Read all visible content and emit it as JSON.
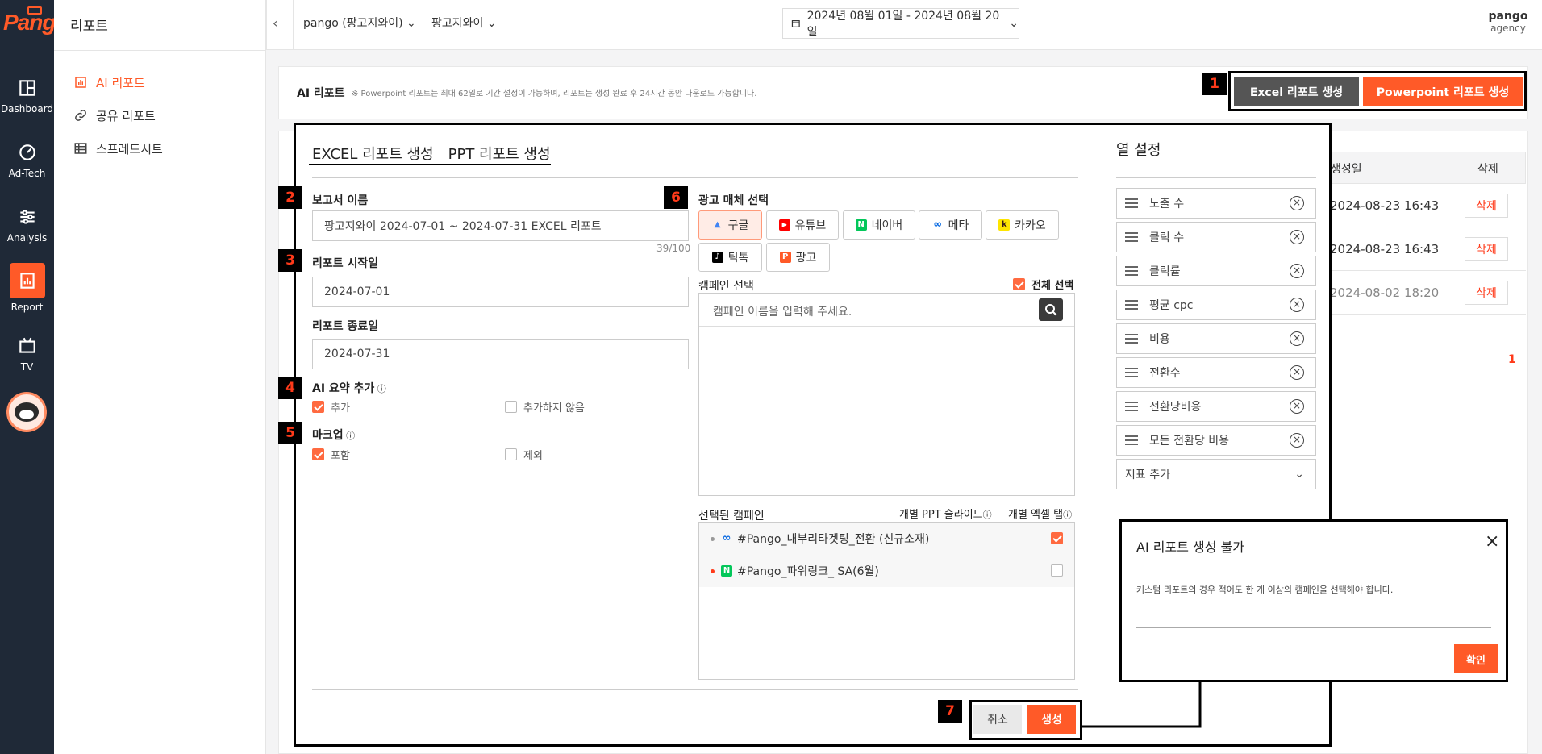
{
  "app": {
    "logo": "Pango",
    "sub_title": "리포트"
  },
  "rail": [
    {
      "label": "Dashboard",
      "icon": "dashboard-icon"
    },
    {
      "label": "Ad-Tech",
      "icon": "adtech-icon"
    },
    {
      "label": "Analysis",
      "icon": "analysis-icon"
    },
    {
      "label": "Report",
      "icon": "report-icon",
      "active": true
    },
    {
      "label": "TV",
      "icon": "tv-icon"
    }
  ],
  "subnav": [
    {
      "label": "AI 리포트",
      "icon": "chart-icon",
      "active": true
    },
    {
      "label": "공유 리포트",
      "icon": "link-icon"
    },
    {
      "label": "스프레드시트",
      "icon": "table-icon"
    }
  ],
  "topbar": {
    "account": "pango (팡고지와이)",
    "advertiser": "팡고지와이",
    "date_range": "2024년 08월 01일 - 2024년 08월 20일",
    "user_name": "pango",
    "user_role": "agency"
  },
  "header": {
    "title": "AI 리포트",
    "notice": "※ Powerpoint 리포트는 최대 62일로 기간 설정이 가능하며, 리포트는 생성 완료 후 24시간 동안 다운로드 가능합니다.",
    "excel_btn": "Excel 리포트 생성",
    "ppt_btn": "Powerpoint 리포트 생성"
  },
  "markers": [
    "1",
    "2",
    "3",
    "4",
    "5",
    "6",
    "7"
  ],
  "table": {
    "col_created": "생성일",
    "col_delete": "삭제",
    "rows": [
      {
        "created": "2024-08-23 16:43",
        "delete": "삭제"
      },
      {
        "created": "2024-08-23 16:43",
        "delete": "삭제"
      },
      {
        "created": "2024-08-02 18:20",
        "delete": "삭제"
      }
    ],
    "page": "1"
  },
  "modal": {
    "tab_excel": "EXCEL 리포트 생성",
    "tab_ppt": "PPT 리포트 생성",
    "report_name_label": "보고서 이름",
    "report_name_value": "팡고지와이 2024-07-01 ~ 2024-07-31 EXCEL 리포트",
    "report_name_count": "39/100",
    "start_label": "리포트 시작일",
    "start_value": "2024-07-01",
    "end_label": "리포트 종료일",
    "end_value": "2024-07-31",
    "ai_label": "AI 요약 추가",
    "ai_opt_add": "추가",
    "ai_opt_none": "추가하지 않음",
    "markup_label": "마크업",
    "markup_opt_in": "포함",
    "markup_opt_out": "제외",
    "media_label": "광고 매체 선택",
    "media": [
      {
        "label": "구글",
        "icon": "google-icon"
      },
      {
        "label": "유튜브",
        "icon": "youtube-icon"
      },
      {
        "label": "네이버",
        "icon": "naver-icon"
      },
      {
        "label": "메타",
        "icon": "meta-icon"
      },
      {
        "label": "카카오",
        "icon": "kakao-icon"
      },
      {
        "label": "틱톡",
        "icon": "tiktok-icon"
      },
      {
        "label": "팡고",
        "icon": "pango-icon"
      }
    ],
    "campaign_label": "캠페인 선택",
    "select_all": "전체 선택",
    "campaign_placeholder": "캠페인 이름을 입력해 주세요.",
    "selected_label": "선택된 캠페인",
    "col_ppt": "개별 PPT 슬라이드",
    "col_excel": "개별 엑셀 탭",
    "selected": [
      {
        "name": "#Pango_내부리타겟팅_전환 (신규소재)",
        "icon": "meta-icon",
        "dot": "#999999",
        "checked": true
      },
      {
        "name": "#Pango_파워링크_ SA(6월)",
        "icon": "naver-icon",
        "dot": "#ff3a1a",
        "checked": false
      }
    ],
    "cancel": "취소",
    "create": "생성",
    "col_settings_title": "열 설정",
    "columns": [
      "노출 수",
      "클릭 수",
      "클릭률",
      "평균 cpc",
      "비용",
      "전환수",
      "전환당비용",
      "모든 전환당 비용"
    ],
    "add_metric": "지표 추가"
  },
  "alert": {
    "title": "AI 리포트 생성 불가",
    "message": "커스텀 리포트의 경우 적어도 한 개 이상의 캠페인을 선택해야 합니다.",
    "ok": "확인"
  },
  "colors": {
    "accent": "#ff5a28",
    "rail": "#1f2937",
    "marker_text": "#ff3a1a"
  }
}
